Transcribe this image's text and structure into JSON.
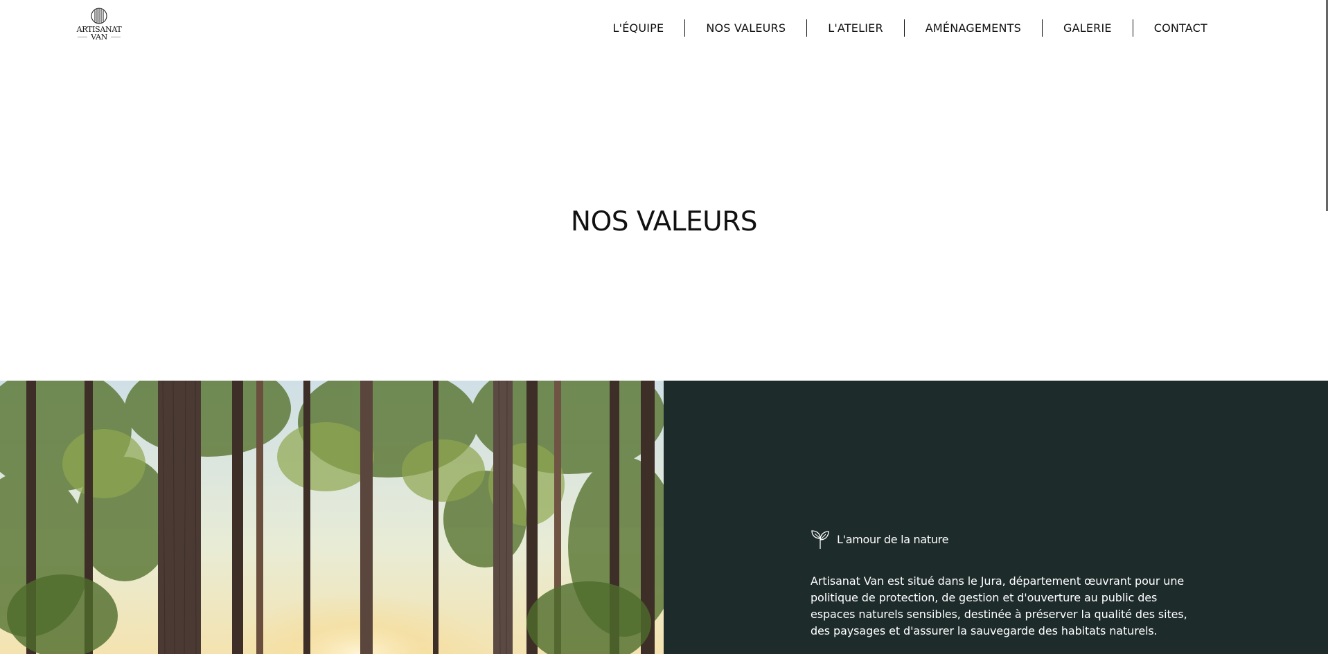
{
  "logo": {
    "line1": "ARTISANAT",
    "line2": "VAN"
  },
  "nav": {
    "items": [
      {
        "label": "L'ÉQUIPE"
      },
      {
        "label": "NOS VALEURS"
      },
      {
        "label": "L'ATELIER"
      },
      {
        "label": "AMÉNAGEMENTS"
      },
      {
        "label": "GALERIE"
      },
      {
        "label": "CONTACT"
      }
    ]
  },
  "hero": {
    "title": "NOS VALEURS"
  },
  "value": {
    "icon": "sprout-icon",
    "title": "L'amour de la nature",
    "text": "Artisanat Van est situé dans le Jura, département œuvrant pour une politique de protection, de gestion et d'ouverture au public des espaces naturels sensibles, destinée à préserver la qualité des sites, des paysages et d'assurer la sauvegarde des habitats naturels."
  },
  "colors": {
    "panel": "#1e2b2b",
    "text": "#111111",
    "accent": "#ffffff"
  }
}
